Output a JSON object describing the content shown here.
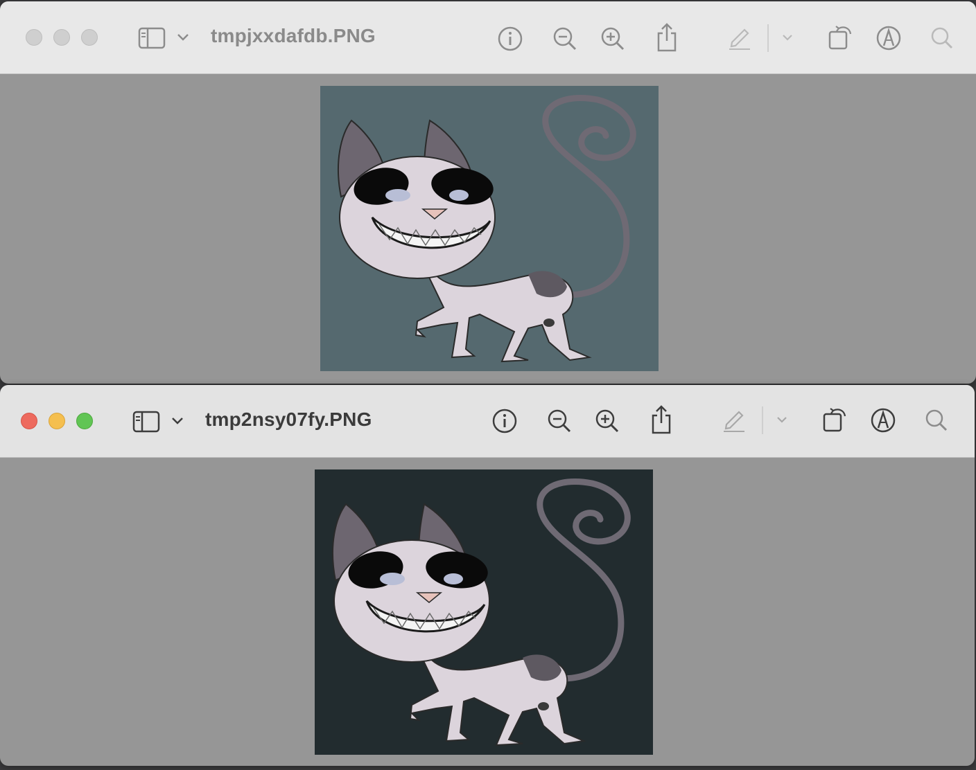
{
  "windows": [
    {
      "title": "tmpjxxdafdb.PNG",
      "state": "inactive",
      "image_background": "#55696f",
      "image_description_icon": "cartoon-cat-image"
    },
    {
      "title": "tmp2nsy07fy.PNG",
      "state": "active",
      "image_background": "#222c2f",
      "image_description_icon": "cartoon-cat-image"
    }
  ],
  "toolbar_icons": [
    "sidebar-icon",
    "chevron-down-icon",
    "info-icon",
    "zoom-out-icon",
    "zoom-in-icon",
    "share-icon",
    "markup-pencil-icon",
    "chevron-down-icon",
    "rotate-icon",
    "annotate-icon",
    "search-icon"
  ],
  "colors": {
    "close": "#ed6a5e",
    "minimize": "#f5bf4f",
    "maximize": "#61c554",
    "window_content_bg": "#969696"
  }
}
